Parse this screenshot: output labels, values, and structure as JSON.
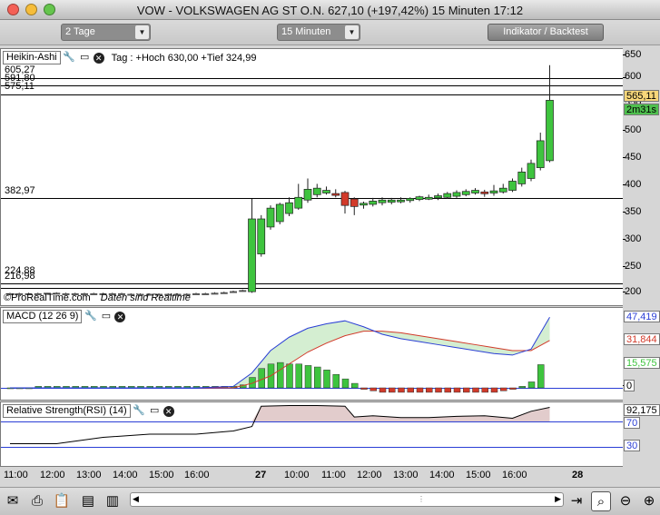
{
  "window": {
    "title": "VOW - VOLKSWAGEN AG ST O.N.      627,10 (+197,42%)      15 Minuten   17:12"
  },
  "toolbar": {
    "period_select": "2 Tage",
    "interval_select": "15 Minuten",
    "indicator_button": "Indikator / Backtest"
  },
  "price_pane": {
    "name": "Heikin-Ashi",
    "info": "Tag : +Hoch 630,00 +Tief 324,99",
    "watermark": "©ProRealTime.com",
    "realtime_note": "Daten sind Realtime",
    "hlines": [
      "605,27",
      "591,80",
      "575,11",
      "382,97",
      "224,88",
      "216,98"
    ],
    "axis_ticks": [
      "650",
      "600",
      "550",
      "500",
      "450",
      "400",
      "350",
      "300",
      "250",
      "200"
    ],
    "last_price": "565,11",
    "countdown": "2m31s"
  },
  "macd_pane": {
    "name": "MACD (12 26 9)",
    "values": [
      "47,419",
      "31,844",
      "15,575"
    ],
    "zero": "0"
  },
  "rsi_pane": {
    "name": "Relative Strength(RSI) (14)",
    "values": [
      "92,175",
      "70",
      "30"
    ]
  },
  "time_axis": [
    "11:00",
    "12:00",
    "13:00",
    "14:00",
    "15:00",
    "16:00",
    "27",
    "10:00",
    "11:00",
    "12:00",
    "13:00",
    "14:00",
    "15:00",
    "16:00",
    "28"
  ],
  "colors": {
    "up": "#3ec43e",
    "down": "#d23a2a",
    "macd_line": "#2a3ed6",
    "signal_line": "#d23a2a",
    "rsi_line": "#000000",
    "rsi_fill": "#e2cccc",
    "last_price_tag": "#f7d77a",
    "countdown_tag": "#4ec04e"
  },
  "chart_data": [
    {
      "type": "candlestick",
      "title": "Heikin-Ashi",
      "ylim": [
        185,
        660
      ],
      "candles": [
        {
          "o": 207,
          "h": 208,
          "l": 206,
          "c": 207
        },
        {
          "o": 207,
          "h": 208,
          "l": 206,
          "c": 207
        },
        {
          "o": 207,
          "h": 208,
          "l": 206,
          "c": 207
        },
        {
          "o": 207,
          "h": 208,
          "l": 206,
          "c": 207
        },
        {
          "o": 207,
          "h": 208,
          "l": 206,
          "c": 208
        },
        {
          "o": 208,
          "h": 209,
          "l": 206,
          "c": 207
        },
        {
          "o": 207,
          "h": 208,
          "l": 206,
          "c": 207
        },
        {
          "o": 207,
          "h": 208,
          "l": 206,
          "c": 207
        },
        {
          "o": 207,
          "h": 208,
          "l": 206,
          "c": 207
        },
        {
          "o": 207,
          "h": 208,
          "l": 206,
          "c": 207
        },
        {
          "o": 207,
          "h": 208,
          "l": 206,
          "c": 207
        },
        {
          "o": 207,
          "h": 208,
          "l": 206,
          "c": 207
        },
        {
          "o": 207,
          "h": 208,
          "l": 205,
          "c": 206
        },
        {
          "o": 206,
          "h": 207,
          "l": 205,
          "c": 206
        },
        {
          "o": 206,
          "h": 207,
          "l": 205,
          "c": 206
        },
        {
          "o": 206,
          "h": 207,
          "l": 205,
          "c": 206
        },
        {
          "o": 206,
          "h": 207,
          "l": 205,
          "c": 206
        },
        {
          "o": 206,
          "h": 207,
          "l": 205,
          "c": 206
        },
        {
          "o": 206,
          "h": 207,
          "l": 205,
          "c": 206
        },
        {
          "o": 206,
          "h": 207,
          "l": 205,
          "c": 206
        },
        {
          "o": 206,
          "h": 208,
          "l": 205,
          "c": 207
        },
        {
          "o": 207,
          "h": 208,
          "l": 206,
          "c": 207
        },
        {
          "o": 207,
          "h": 209,
          "l": 206,
          "c": 208
        },
        {
          "o": 208,
          "h": 210,
          "l": 207,
          "c": 209
        },
        {
          "o": 209,
          "h": 212,
          "l": 208,
          "c": 211
        },
        {
          "o": 211,
          "h": 214,
          "l": 210,
          "c": 213
        },
        {
          "o": 210,
          "h": 382,
          "l": 208,
          "c": 345
        },
        {
          "o": 280,
          "h": 352,
          "l": 275,
          "c": 345
        },
        {
          "o": 330,
          "h": 370,
          "l": 325,
          "c": 365
        },
        {
          "o": 340,
          "h": 375,
          "l": 335,
          "c": 372
        },
        {
          "o": 355,
          "h": 385,
          "l": 350,
          "c": 375
        },
        {
          "o": 365,
          "h": 410,
          "l": 362,
          "c": 385
        },
        {
          "o": 380,
          "h": 420,
          "l": 375,
          "c": 400
        },
        {
          "o": 390,
          "h": 410,
          "l": 385,
          "c": 402
        },
        {
          "o": 393,
          "h": 405,
          "l": 390,
          "c": 398
        },
        {
          "o": 392,
          "h": 400,
          "l": 385,
          "c": 390
        },
        {
          "o": 394,
          "h": 397,
          "l": 355,
          "c": 370
        },
        {
          "o": 382,
          "h": 385,
          "l": 352,
          "c": 368
        },
        {
          "o": 371,
          "h": 377,
          "l": 364,
          "c": 374
        },
        {
          "o": 372,
          "h": 384,
          "l": 368,
          "c": 378
        },
        {
          "o": 375,
          "h": 385,
          "l": 370,
          "c": 380
        },
        {
          "o": 376,
          "h": 384,
          "l": 372,
          "c": 380
        },
        {
          "o": 378,
          "h": 385,
          "l": 374,
          "c": 380
        },
        {
          "o": 379,
          "h": 385,
          "l": 375,
          "c": 383
        },
        {
          "o": 381,
          "h": 388,
          "l": 378,
          "c": 386
        },
        {
          "o": 383,
          "h": 390,
          "l": 380,
          "c": 385
        },
        {
          "o": 384,
          "h": 392,
          "l": 380,
          "c": 388
        },
        {
          "o": 385,
          "h": 395,
          "l": 382,
          "c": 392
        },
        {
          "o": 387,
          "h": 398,
          "l": 384,
          "c": 394
        },
        {
          "o": 390,
          "h": 400,
          "l": 387,
          "c": 396
        },
        {
          "o": 393,
          "h": 402,
          "l": 390,
          "c": 398
        },
        {
          "o": 395,
          "h": 399,
          "l": 386,
          "c": 392
        },
        {
          "o": 393,
          "h": 408,
          "l": 388,
          "c": 397
        },
        {
          "o": 395,
          "h": 410,
          "l": 392,
          "c": 402
        },
        {
          "o": 398,
          "h": 420,
          "l": 395,
          "c": 415
        },
        {
          "o": 410,
          "h": 440,
          "l": 405,
          "c": 432
        },
        {
          "o": 420,
          "h": 455,
          "l": 415,
          "c": 448
        },
        {
          "o": 440,
          "h": 505,
          "l": 435,
          "c": 490
        },
        {
          "o": 453,
          "h": 630,
          "l": 450,
          "c": 565
        }
      ]
    },
    {
      "type": "line",
      "title": "MACD (12 26 9)",
      "ylim": [
        -2,
        50
      ],
      "x": [
        0,
        5,
        10,
        15,
        20,
        24,
        26,
        28,
        30,
        32,
        34,
        36,
        38,
        40,
        42,
        44,
        46,
        48,
        50,
        52,
        54,
        56,
        58
      ],
      "series": [
        {
          "name": "MACD",
          "values": [
            0,
            0,
            0,
            0,
            0,
            1,
            10,
            25,
            34,
            40,
            43,
            45,
            41,
            36,
            33,
            31,
            29,
            27,
            25,
            23,
            22,
            26,
            47.419
          ]
        },
        {
          "name": "Signal",
          "values": [
            0,
            0,
            0,
            0,
            0,
            0,
            3,
            8,
            16,
            24,
            30,
            35,
            38,
            38,
            37,
            35,
            33,
            31,
            29,
            27,
            25,
            25,
            31.844
          ]
        }
      ],
      "histogram": [
        0,
        0,
        0,
        1,
        1,
        1,
        1,
        1,
        1,
        1,
        1,
        1,
        1,
        1,
        1,
        1,
        1,
        1,
        1,
        1,
        1,
        1,
        1,
        1,
        1,
        2,
        7,
        13,
        16,
        17,
        16,
        16,
        15,
        14,
        12,
        9,
        6,
        3,
        -1,
        -2,
        -3,
        -3,
        -3,
        -3,
        -3,
        -3,
        -3,
        -3,
        -3,
        -3,
        -3,
        -3,
        -3,
        -2,
        -1,
        1,
        4,
        15.575
      ]
    },
    {
      "type": "line",
      "title": "Relative Strength(RSI) (14)",
      "ylim": [
        0,
        100
      ],
      "x": [
        0,
        5,
        10,
        15,
        20,
        24,
        26,
        27,
        30,
        33,
        36,
        37,
        39,
        42,
        45,
        48,
        51,
        54,
        56,
        58
      ],
      "series": [
        {
          "name": "RSI",
          "values": [
            35,
            35,
            45,
            50,
            50,
            55,
            62,
            94,
            95,
            95,
            94,
            77,
            79,
            76,
            76,
            78,
            79,
            75,
            86,
            92.175
          ]
        }
      ],
      "levels": [
        70,
        30
      ]
    }
  ]
}
